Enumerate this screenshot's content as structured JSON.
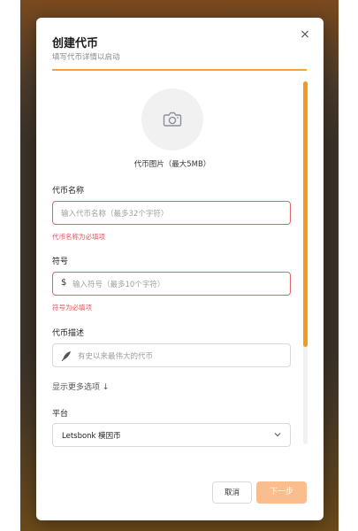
{
  "modal": {
    "title": "创建代币",
    "subtitle": "填写代币详情以启动",
    "close_icon": "×"
  },
  "image_upload": {
    "label": "代币图片（最大5MB）",
    "icon": "camera-icon"
  },
  "fields": {
    "name": {
      "label": "代币名称",
      "placeholder": "输入代币名称（最多32个字符）",
      "error": "代币名称为必填项"
    },
    "symbol": {
      "label": "符号",
      "prefix": "$",
      "placeholder": "输入符号（最多10个字符）",
      "error": "符号为必填项"
    },
    "description": {
      "label": "代币描述",
      "placeholder": "有史以来最伟大的代币",
      "icon": "feather-icon"
    }
  },
  "more_options": {
    "label": "显示更多选项 ↓"
  },
  "platform": {
    "label": "平台",
    "selected": "Letsbonk 模因币"
  },
  "actions": {
    "cancel": "取消",
    "next": "下一步"
  },
  "colors": {
    "accent": "#f39b1c",
    "error": "#e0565d",
    "next_button": "#f9bd8e"
  }
}
